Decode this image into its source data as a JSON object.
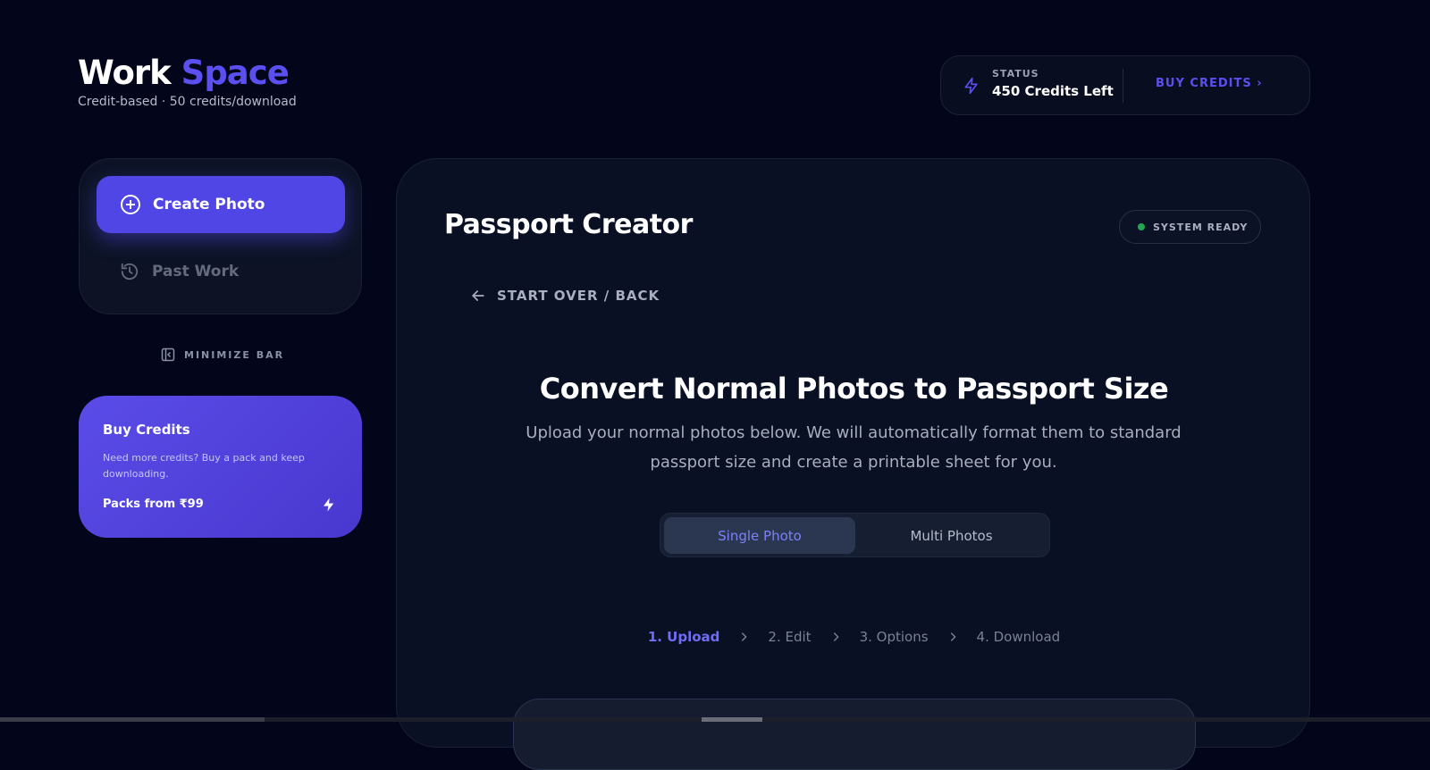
{
  "brand": {
    "title_part1": "Work",
    "title_part2": "Space",
    "subtitle": "Credit-based · 50 credits/download"
  },
  "status": {
    "label": "STATUS",
    "value": "450 Credits Left",
    "buy_link": "BUY CREDITS ›",
    "icon": "lightning-icon"
  },
  "nav": {
    "create_label": "Create Photo",
    "past_label": "Past Work",
    "minimize_label": "MINIMIZE BAR"
  },
  "buy_card": {
    "title": "Buy Credits",
    "text": "Need more credits? Buy a pack and keep downloading.",
    "packs": "Packs from ₹99"
  },
  "main": {
    "title": "Passport Creator",
    "system_status": "SYSTEM READY",
    "back_label": "START OVER / BACK",
    "heading": "Convert Normal Photos to Passport Size",
    "subtext": "Upload your normal photos below. We will automatically format them to standard passport size and create a printable sheet for you.",
    "toggle": {
      "single": "Single Photo",
      "multi": "Multi Photos"
    },
    "steps": [
      "1. Upload",
      "2. Edit",
      "3. Options",
      "4. Download"
    ]
  },
  "colors": {
    "background": "#03061a",
    "accent": "#5046e6",
    "ready": "#22a651"
  }
}
